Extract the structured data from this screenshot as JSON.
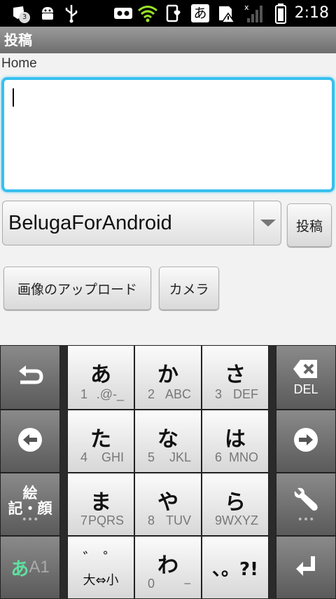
{
  "status_bar": {
    "notification_count": "3",
    "ime_indicator": "あ",
    "time": "2:18"
  },
  "title_bar": {
    "title": "投稿"
  },
  "form": {
    "account_label": "Home",
    "post_text": "",
    "client_selected": "BelugaForAndroid",
    "post_button": "投稿",
    "upload_button": "画像のアップロード",
    "camera_button": "カメラ"
  },
  "keyboard": {
    "keys": [
      {
        "kana": "あ",
        "num": "1",
        "chars": ".@-_"
      },
      {
        "kana": "か",
        "num": "2",
        "chars": "ABC"
      },
      {
        "kana": "さ",
        "num": "3",
        "chars": "DEF"
      },
      {
        "kana": "た",
        "num": "4",
        "chars": "GHI"
      },
      {
        "kana": "な",
        "num": "5",
        "chars": "JKL"
      },
      {
        "kana": "は",
        "num": "6",
        "chars": "MNO"
      },
      {
        "kana": "ま",
        "num": "7",
        "chars": "PQRS"
      },
      {
        "kana": "や",
        "num": "8",
        "chars": "TUV"
      },
      {
        "kana": "ら",
        "num": "9",
        "chars": "WXYZ"
      }
    ],
    "dakuten_top": "゛ ゜",
    "dakuten_bottom": "大⇔小",
    "wa_kana": "わ",
    "wa_num": "0",
    "wa_chars": "−",
    "punct": "、。?!",
    "emoji_line1": "絵",
    "emoji_line2": "記・顔",
    "mode_label_a": "あ",
    "mode_label_b": "A1",
    "del_label": "DEL"
  },
  "colors": {
    "accent": "#38c0ee",
    "wifi": "#9be02a",
    "mode_green": "#5fe0a0"
  },
  "icons": [
    "notification-icon",
    "android-icon",
    "usb-icon",
    "voicemail-icon",
    "wifi-icon",
    "phone-heart-icon",
    "sd-warning-icon",
    "signal-icon",
    "battery-icon",
    "undo-icon",
    "delete-icon",
    "left-arrow-icon",
    "right-arrow-icon",
    "wrench-icon",
    "enter-icon"
  ]
}
